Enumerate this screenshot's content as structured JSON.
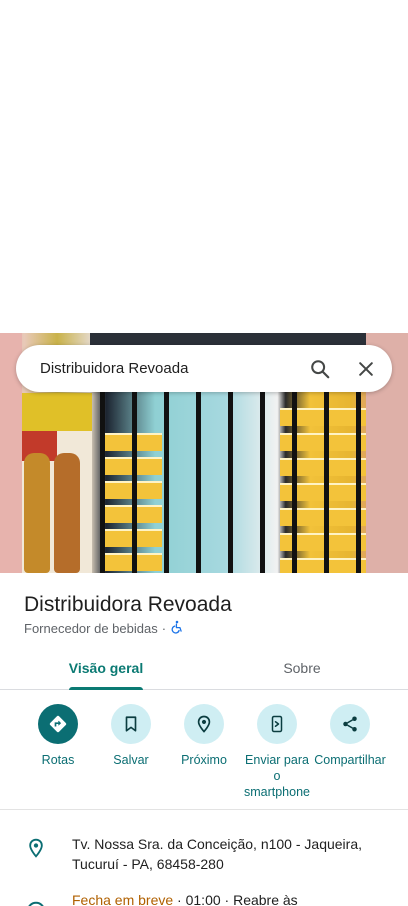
{
  "search": {
    "query": "Distribuidora Revoada"
  },
  "place": {
    "name": "Distribuidora Revoada",
    "category": "Fornecedor de bebidas",
    "separator": "·"
  },
  "tabs": [
    {
      "label": "Visão geral",
      "active": true
    },
    {
      "label": "Sobre",
      "active": false
    }
  ],
  "actions": [
    {
      "label": "Rotas",
      "icon": "directions-icon"
    },
    {
      "label": "Salvar",
      "icon": "bookmark-icon"
    },
    {
      "label": "Próximo",
      "icon": "nearby-icon"
    },
    {
      "label": "Enviar para o smartphone",
      "icon": "send-to-phone-icon"
    },
    {
      "label": "Compartilhar",
      "icon": "share-icon"
    }
  ],
  "info": {
    "address": "Tv. Nossa Sra. da Conceição, n100 - Jaqueira, Tucuruí - PA, 68458-280",
    "hours_status": "Fecha em breve",
    "hours_rest": " · 01:00 · Reabre às"
  },
  "colors": {
    "accent": "#0b7a73",
    "warning": "#b06000"
  }
}
